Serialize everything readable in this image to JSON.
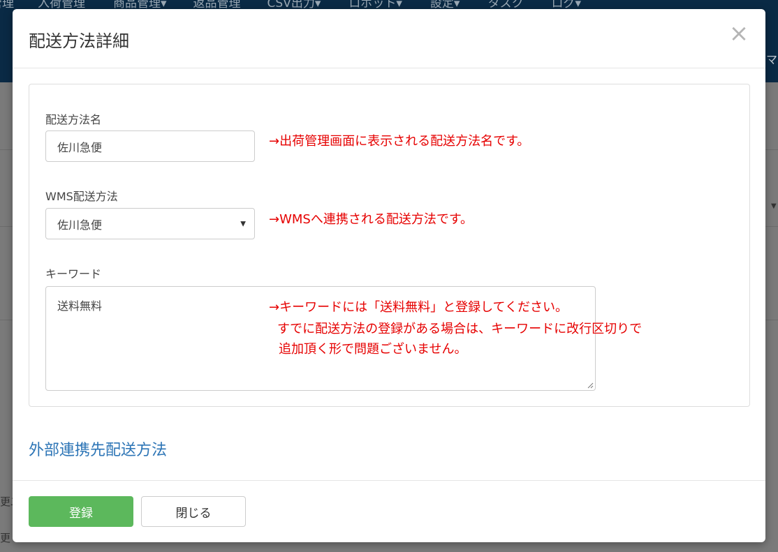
{
  "background": {
    "nav_items": [
      "管理",
      "入荷管理",
      "商品管理▾",
      "返品管理",
      "CSV出力▾",
      "ロボット▾",
      "設定▾",
      "タスク",
      "ログ▾"
    ],
    "right_edge_text": "マ",
    "left_edge_a": "更二",
    "left_edge_b": "更"
  },
  "modal": {
    "title": "配送方法詳細",
    "close_symbol": "×",
    "fields": {
      "name": {
        "label": "配送方法名",
        "value": "佐川急便"
      },
      "wms": {
        "label": "WMS配送方法",
        "value": "佐川急便"
      },
      "keyword": {
        "label": "キーワード",
        "value": "送料無料"
      }
    },
    "notes": {
      "name_note": "→出荷管理画面に表示される配送方法名です。",
      "wms_note": "→WMSへ連携される配送方法です。",
      "keyword_note_1": "→キーワードには「送料無料」と登録してください。",
      "keyword_note_2": "すでに配送方法の登録がある場合は、キーワードに改行区切りで",
      "keyword_note_3": "追加頂く形で問題ございません。"
    },
    "section_link": "外部連携先配送方法",
    "footer": {
      "submit_label": "登録",
      "close_label": "閉じる"
    }
  },
  "colors": {
    "accent_link": "#2d75b6",
    "primary_button": "#5cb85c",
    "note_red": "#e60000",
    "nav_bg": "#0a2a45"
  }
}
